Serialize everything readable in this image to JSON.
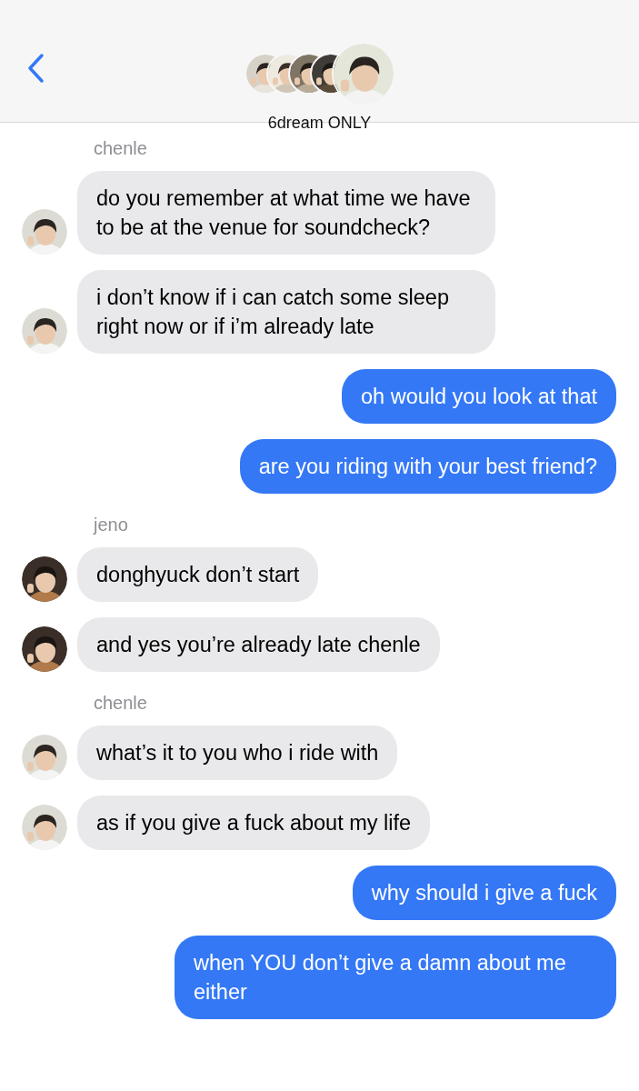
{
  "header": {
    "title": "6dream ONLY"
  },
  "messages": [
    {
      "kind": "sender",
      "text": "chenle"
    },
    {
      "kind": "incoming",
      "text": "do you remember at what time we have to be at the venue for soundcheck?"
    },
    {
      "kind": "incoming",
      "text": "i don’t know if i can catch some sleep right now or if i’m already late"
    },
    {
      "kind": "outgoing",
      "text": "oh would you look at that"
    },
    {
      "kind": "outgoing",
      "text": "are you riding with your best friend?"
    },
    {
      "kind": "sender",
      "text": "jeno"
    },
    {
      "kind": "incoming",
      "text": "donghyuck don’t start"
    },
    {
      "kind": "incoming",
      "text": "and yes you’re already late chenle"
    },
    {
      "kind": "sender",
      "text": "chenle"
    },
    {
      "kind": "incoming",
      "text": "what’s it to you who i ride with"
    },
    {
      "kind": "incoming",
      "text": "as if you give a fuck about my life"
    },
    {
      "kind": "outgoing",
      "text": "why should i give a fuck"
    },
    {
      "kind": "outgoing",
      "text": "when YOU don’t give a damn about me either"
    }
  ]
}
